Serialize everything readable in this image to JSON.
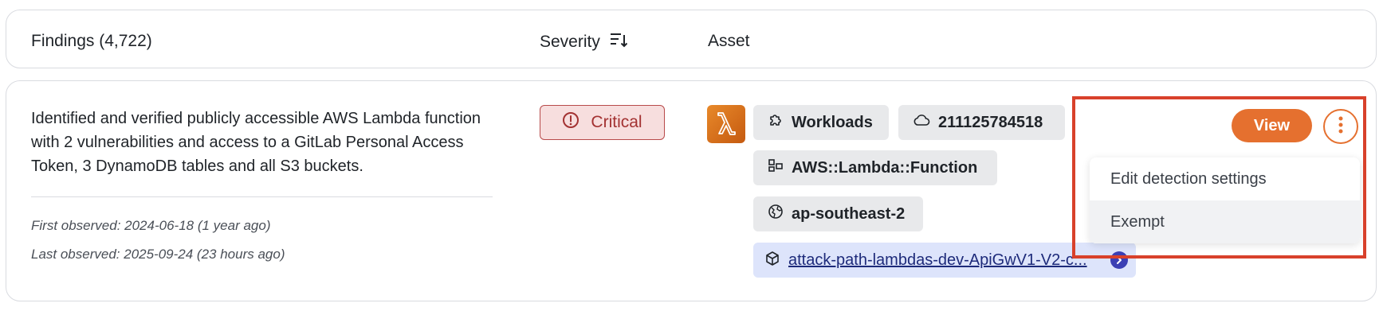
{
  "header": {
    "findings_label": "Findings (4,722)",
    "severity_label": "Severity",
    "asset_label": "Asset"
  },
  "finding": {
    "description": "Identified and verified publicly accessible AWS Lambda function with 2 vulnerabilities and access to a GitLab Personal Access Token, 3 DynamoDB tables and all S3 buckets.",
    "first_observed": "First observed: 2024-06-18 (1 year ago)",
    "last_observed": "Last observed: 2025-09-24 (23 hours ago)",
    "severity": "Critical",
    "asset": {
      "category": "Workloads",
      "account_id": "211125784518",
      "resource_type": "AWS::Lambda::Function",
      "region": "ap-southeast-2",
      "resource_name": "attack-path-lambdas-dev-ApiGwV1-V2-c..."
    },
    "actions": {
      "view_label": "View"
    }
  },
  "menu": {
    "items": [
      {
        "label": "Edit detection settings"
      },
      {
        "label": "Exempt"
      }
    ]
  },
  "colors": {
    "accent": "#e5702f",
    "critical_text": "#a33232",
    "critical_bg": "#f7dede",
    "highlight": "#d8412b",
    "link": "#1d2a7a"
  }
}
